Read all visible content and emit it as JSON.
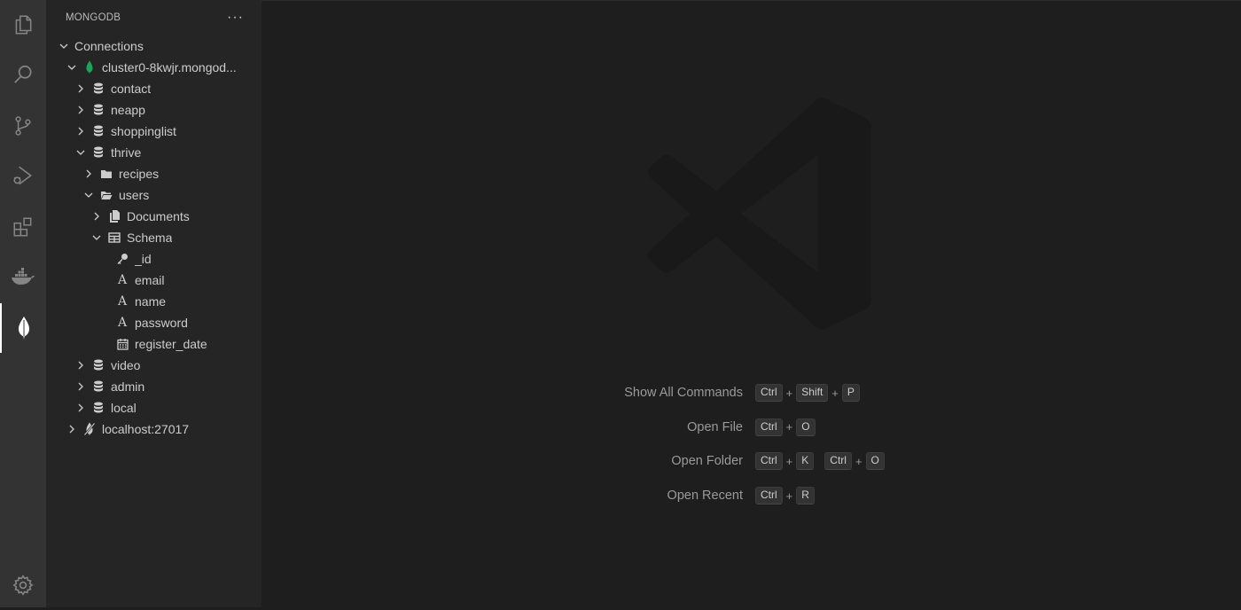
{
  "sidebar": {
    "title": "MONGODB",
    "more_label": "···",
    "tree": {
      "connections": "Connections",
      "cluster": "cluster0-8kwjr.mongod...",
      "db_contact": "contact",
      "db_neapp": "neapp",
      "db_shoppinglist": "shoppinglist",
      "db_thrive": "thrive",
      "coll_recipes": "recipes",
      "coll_users": "users",
      "documents": "Documents",
      "schema": "Schema",
      "field_id": "_id",
      "field_email": "email",
      "field_name": "name",
      "field_password": "password",
      "field_register_date": "register_date",
      "db_video": "video",
      "db_admin": "admin",
      "db_local": "local",
      "localhost": "localhost:27017"
    }
  },
  "activity_bar": {
    "icons": [
      "explorer-icon",
      "search-icon",
      "source-control-icon",
      "run-debug-icon",
      "extensions-icon",
      "docker-icon",
      "mongodb-leaf-icon",
      "settings-gear-icon"
    ]
  },
  "editor": {
    "shortcuts": {
      "show_all": {
        "label": "Show All Commands",
        "k1": "Ctrl",
        "plus1": "+",
        "k2": "Shift",
        "plus2": "+",
        "k3": "P"
      },
      "open_file": {
        "label": "Open File",
        "k1": "Ctrl",
        "plus1": "+",
        "k2": "O"
      },
      "open_folder": {
        "label": "Open Folder",
        "k1": "Ctrl",
        "plus1": "+",
        "k2": "K",
        "k3": "Ctrl",
        "plus2": "+",
        "k4": "O"
      },
      "open_recent": {
        "label": "Open Recent",
        "k1": "Ctrl",
        "plus1": "+",
        "k2": "R"
      }
    }
  },
  "colors": {
    "activity_bar": "#333333",
    "sidebar": "#252526",
    "editor": "#1e1e1e",
    "mongo_green": "#13aa52"
  }
}
